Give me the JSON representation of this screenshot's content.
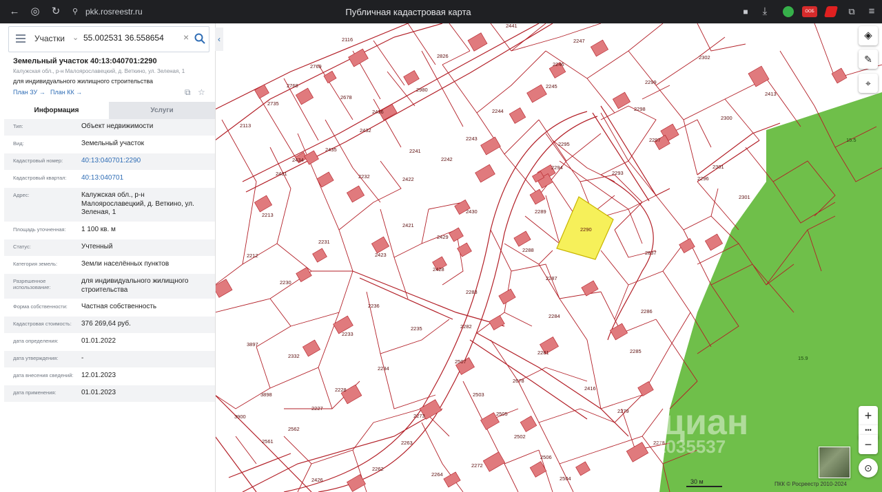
{
  "browser": {
    "url": "pkk.rosreestr.ru",
    "title": "Публичная кадастровая карта",
    "ext_badge": "ООБ"
  },
  "search": {
    "type": "Участки",
    "query": "55.002531 36.558654"
  },
  "parcel": {
    "title": "Земельный участок 40:13:040701:2290",
    "address": "Калужская обл., р-н Малоярославецкий, д. Веткино, ул. Зеленая, 1",
    "use": "для индивидуального жилищного строительства",
    "link_zu": "План ЗУ →",
    "link_kk": "План КК →"
  },
  "tabs": {
    "info": "Информация",
    "services": "Услуги"
  },
  "rows": [
    {
      "label": "Тип:",
      "value": "Объект недвижимости"
    },
    {
      "label": "Вид:",
      "value": "Земельный участок"
    },
    {
      "label": "Кадастровый номер:",
      "value": "40:13:040701:2290"
    },
    {
      "label": "Кадастровый квартал:",
      "value": "40:13:040701"
    },
    {
      "label": "Адрес:",
      "value": "Калужская обл., р-н Малоярославецкий, д. Веткино, ул. Зеленая, 1"
    },
    {
      "label": "Площадь уточненная:",
      "value": "1 100 кв. м"
    },
    {
      "label": "Статус:",
      "value": "Учтенный"
    },
    {
      "label": "Категория земель:",
      "value": "Земли населённых пунктов"
    },
    {
      "label": "Разрешенное использование:",
      "value": "для индивидуального жилищного строительства"
    },
    {
      "label": "Форма собственности:",
      "value": "Частная собственность"
    },
    {
      "label": "Кадастровая стоимость:",
      "value": "376 269,64 руб."
    },
    {
      "label": "дата определения:",
      "value": "01.01.2022"
    },
    {
      "label": "дата утверждения:",
      "value": "-"
    },
    {
      "label": "дата внесения сведений:",
      "value": "12.01.2023"
    },
    {
      "label": "дата применения:",
      "value": "01.01.2023"
    }
  ],
  "map": {
    "scale": "30 м",
    "copyright": "ПКК © Росреестр 2010-2024",
    "watermark": "циан",
    "watermark_id": "1035537",
    "selected_parcel": "2290",
    "green_labels": [
      "15.5",
      "15.9"
    ],
    "parcel_labels": [
      "2441",
      "2116",
      "2826",
      "2247",
      "2302",
      "2769",
      "2980",
      "2246",
      "2413",
      "2768",
      "2678",
      "2245",
      "2299",
      "2735",
      "2244",
      "2298",
      "2113",
      "2436",
      "2432",
      "2300",
      "2243",
      "2297",
      "2295",
      "2241",
      "2294",
      "2301",
      "2435",
      "2434",
      "2242",
      "2293",
      "2296",
      "2431",
      "2422",
      "2232",
      "2430",
      "2289",
      "2290",
      "2301",
      "2213",
      "2421",
      "2837",
      "2231",
      "2429",
      "2288",
      "2212",
      "2423",
      "2428",
      "2287",
      "2230",
      "2283",
      "2236",
      "2284",
      "2286",
      "2282",
      "2235",
      "2233",
      "3897",
      "2281",
      "2285",
      "2332",
      "2234",
      "2507",
      "2678",
      "2416",
      "2228",
      "2503",
      "2279",
      "3898",
      "2227",
      "2273",
      "2505",
      "3900",
      "2562",
      "2502",
      "2278",
      "2561",
      "2263",
      "2506",
      "2262",
      "2272",
      "2504",
      "2426",
      "2264"
    ],
    "icons": {
      "layers": "layers-icon",
      "ruler": "ruler-icon",
      "locate": "locate-icon",
      "zoom_in": "+",
      "more": "•••",
      "zoom_out": "−"
    }
  }
}
